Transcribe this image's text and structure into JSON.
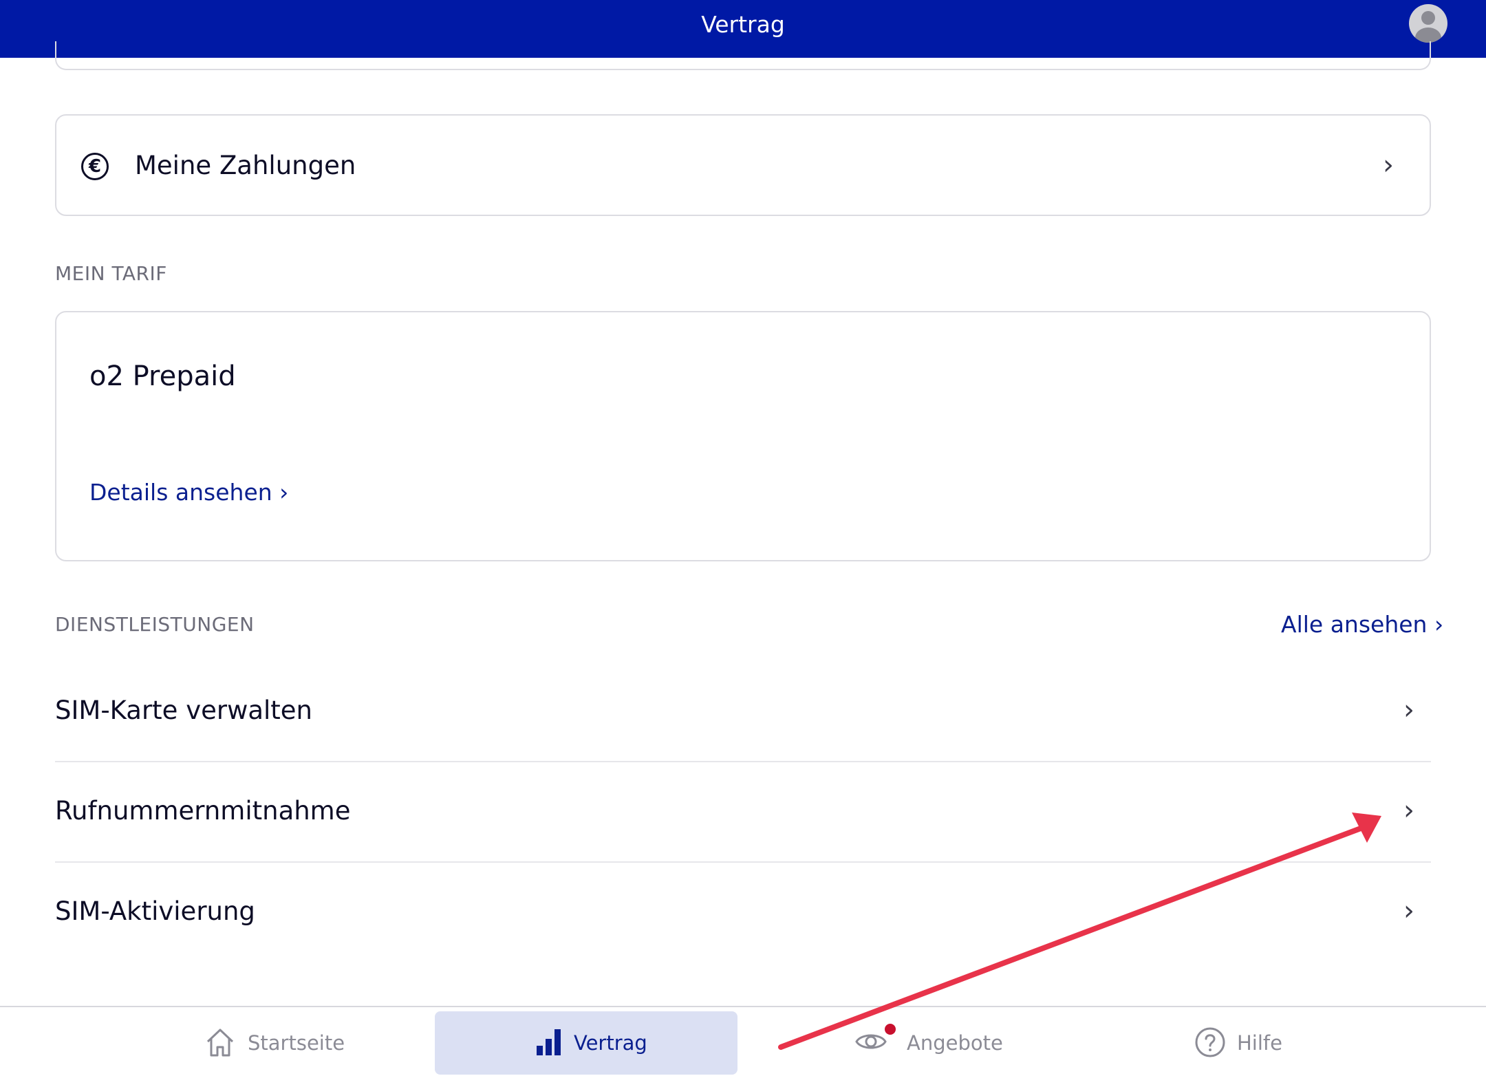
{
  "header": {
    "title": "Vertrag",
    "avatar_icon": "user-avatar-icon"
  },
  "payments": {
    "label": "Meine Zahlungen",
    "icon": "euro-icon"
  },
  "tariff": {
    "section_label": "MEIN TARIF",
    "name": "o2 Prepaid",
    "details_link": "Details ansehen ›"
  },
  "services": {
    "section_label": "DIENSTLEISTUNGEN",
    "all_link": "Alle ansehen ›",
    "items": [
      {
        "label": "SIM-Karte verwalten"
      },
      {
        "label": "Rufnummernmitnahme"
      },
      {
        "label": "SIM-Aktivierung"
      }
    ]
  },
  "nav": {
    "items": [
      {
        "label": "Startseite",
        "icon": "home-icon"
      },
      {
        "label": "Vertrag",
        "icon": "bar-chart-icon",
        "active": true
      },
      {
        "label": "Angebote",
        "icon": "eye-icon",
        "badge": true
      },
      {
        "label": "Hilfe",
        "icon": "help-circle-icon"
      }
    ]
  },
  "colors": {
    "header_bg": "#0019a5",
    "link": "#0a1f8f",
    "nav_active_bg": "#dbe0f3",
    "badge": "#c8102e",
    "annotation_arrow": "#e8334a"
  }
}
